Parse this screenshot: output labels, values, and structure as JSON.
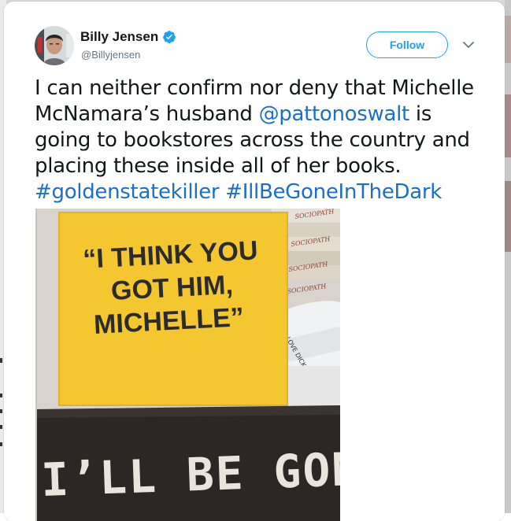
{
  "author": {
    "display_name": "Billy Jensen",
    "handle": "@Billyjensen",
    "verified": true
  },
  "actions": {
    "follow_label": "Follow"
  },
  "tweet": {
    "text_1": "I can neither confirm nor deny that Michelle McNamara’s husband ",
    "mention": "@pattonoswalt",
    "text_2": " is going to bookstores across the country and placing these inside all of her books. ",
    "hashtag_1": "#goldenstatekiller",
    "text_3": " ",
    "hashtag_2": "#IllBeGoneInTheDark"
  },
  "media": {
    "sign_line_1": "“I THINK YOU",
    "sign_line_2": "GOT HIM,",
    "sign_line_3": "MICHELLE”",
    "book_title": "I’LL BE GONE",
    "spines": [
      "SOCIOPATH",
      "SOCIOPATH",
      "SOCIOPATH",
      "SOCIOPATH"
    ],
    "spine_small": "LOVE DICK"
  },
  "colors": {
    "link": "#1b6fc7",
    "twitter_blue": "#1da1f2",
    "sign_yellow": "#f4c731",
    "text": "#14171a"
  }
}
